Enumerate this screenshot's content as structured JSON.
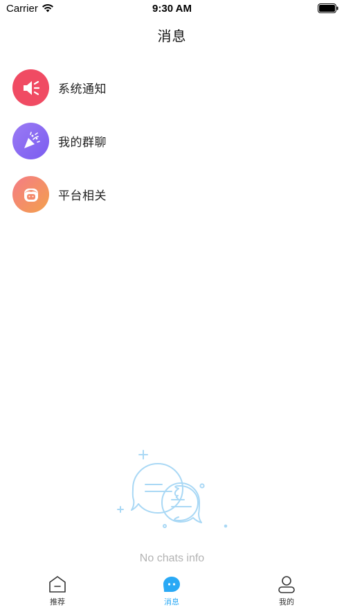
{
  "status_bar": {
    "carrier": "Carrier",
    "time": "9:30 AM",
    "icons": [
      "wifi-icon",
      "battery-icon"
    ]
  },
  "nav": {
    "title": "消息"
  },
  "messages": [
    {
      "label": "系统通知",
      "icon": "speaker-icon",
      "color": "#f04b63"
    },
    {
      "label": "我的群聊",
      "icon": "party-popper-icon",
      "color": "#8a6cf0"
    },
    {
      "label": "平台相关",
      "icon": "mascot-icon",
      "color": "#f28a5c"
    }
  ],
  "empty_state": {
    "text": "No chats info",
    "icon": "chat-bubbles-icon",
    "color": "#a9d8f5"
  },
  "tab_bar": {
    "active_color": "#2aa9f5",
    "tabs": [
      {
        "label": "推荐",
        "icon": "home-icon",
        "active": false
      },
      {
        "label": "消息",
        "icon": "message-icon",
        "active": true
      },
      {
        "label": "我的",
        "icon": "profile-icon",
        "active": false
      }
    ]
  }
}
